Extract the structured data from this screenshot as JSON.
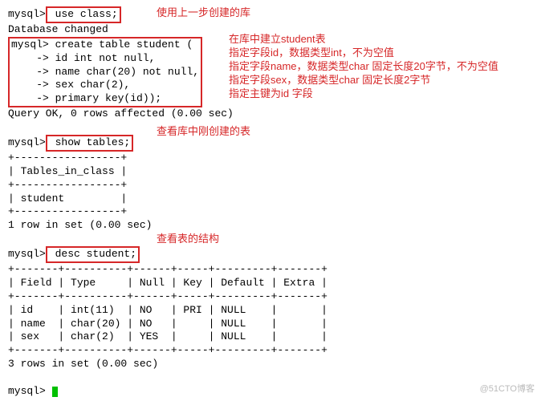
{
  "term": {
    "prompt": "mysql>",
    "arrow": "    ->",
    "cmd1": " use class;",
    "resp1": "Database changed",
    "cmd2": " create table student (",
    "cmd2a": " id int not null,",
    "cmd2b": " name char(20) not null,",
    "cmd2c": " sex char(2),",
    "cmd2d": " primary key(id));",
    "resp2": "Query OK, 0 rows affected (0.00 sec)",
    "cmd3": " show tables;",
    "sep1": "+-----------------+",
    "hdr1": "| Tables_in_class |",
    "row1": "| student         |",
    "resp3": "1 row in set (0.00 sec)",
    "cmd4": " desc student;",
    "sep2": "+-------+----------+------+-----+---------+-------+",
    "hdr2": "| Field | Type     | Null | Key | Default | Extra |",
    "drow1": "| id    | int(11)  | NO   | PRI | NULL    |       |",
    "drow2": "| name  | char(20) | NO   |     | NULL    |       |",
    "drow3": "| sex   | char(2)  | YES  |     | NULL    |       |",
    "resp4": "3 rows in set (0.00 sec)"
  },
  "anno": {
    "a1": "使用上一步创建的库",
    "a2a": "在库中建立student表",
    "a2b": "指定字段id，数据类型int，不为空值",
    "a2c": "指定字段name，数据类型char 固定长度20字节，不为空值",
    "a2d": "指定字段sex，数据类型char 固定长度2字节",
    "a2e": "指定主键为id 字段",
    "a3": "查看库中刚创建的表",
    "a4": "查看表的结构"
  },
  "watermark": "@51CTO博客",
  "chart_data": {
    "type": "table",
    "title": "desc student;",
    "columns": [
      "Field",
      "Type",
      "Null",
      "Key",
      "Default",
      "Extra"
    ],
    "rows": [
      [
        "id",
        "int(11)",
        "NO",
        "PRI",
        "NULL",
        ""
      ],
      [
        "name",
        "char(20)",
        "NO",
        "",
        "NULL",
        ""
      ],
      [
        "sex",
        "char(2)",
        "YES",
        "",
        "NULL",
        ""
      ]
    ]
  }
}
